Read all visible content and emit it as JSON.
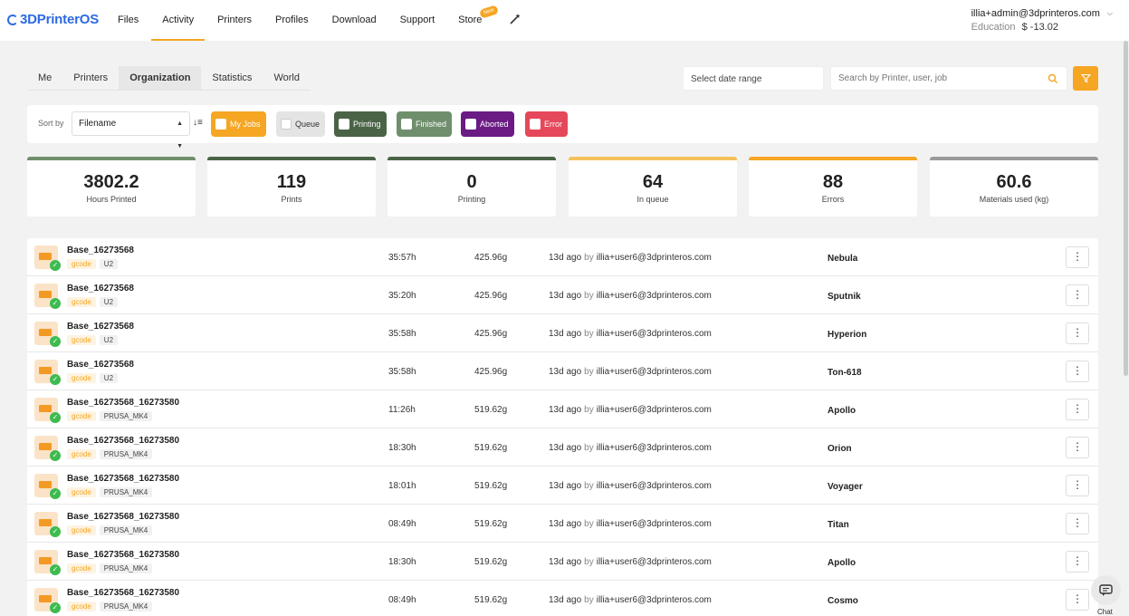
{
  "app": {
    "logo_text": "3DPrinterOS"
  },
  "nav": {
    "items": [
      {
        "label": "Files"
      },
      {
        "label": "Activity",
        "active": true
      },
      {
        "label": "Printers"
      },
      {
        "label": "Profiles"
      },
      {
        "label": "Download"
      },
      {
        "label": "Support"
      },
      {
        "label": "Store",
        "badge": "New"
      }
    ]
  },
  "user": {
    "email": "illia+admin@3dprinteros.com",
    "plan": "Education",
    "balance": "$ -13.02"
  },
  "subtabs": [
    {
      "label": "Me"
    },
    {
      "label": "Printers"
    },
    {
      "label": "Organization",
      "active": true
    },
    {
      "label": "Statistics"
    },
    {
      "label": "World"
    }
  ],
  "date_range": {
    "placeholder": "Select date range"
  },
  "search": {
    "placeholder": "Search by Printer, user, job"
  },
  "sort": {
    "label": "Sort by",
    "value": "Filename"
  },
  "filters": [
    {
      "label": "My Jobs",
      "color": "#f5a623"
    },
    {
      "label": "Queue",
      "color": "#e4e4e4"
    },
    {
      "label": "Printing",
      "color": "#4a6346"
    },
    {
      "label": "Finished",
      "color": "#6f8f6c"
    },
    {
      "label": "Aborted",
      "color": "#6a1b84"
    },
    {
      "label": "Error",
      "color": "#e5485a"
    }
  ],
  "stats": [
    {
      "value": "3802.2",
      "label": "Hours Printed",
      "color": "#6f8f6c"
    },
    {
      "value": "119",
      "label": "Prints",
      "color": "#4a6346"
    },
    {
      "value": "0",
      "label": "Printing",
      "color": "#4a6346"
    },
    {
      "value": "64",
      "label": "In queue",
      "color": "#f5c15a"
    },
    {
      "value": "88",
      "label": "Errors",
      "color": "#f5a623"
    },
    {
      "value": "60.6",
      "label": "Materials used (kg)",
      "color": "#9a9a9a"
    }
  ],
  "jobs": [
    {
      "name": "Base_16273568",
      "type": "gcode",
      "model": "U2",
      "duration": "35:57h",
      "weight": "425.96g",
      "ago": "13d ago",
      "by": "by",
      "user": "illia+user6@3dprinteros.com",
      "printer": "Nebula"
    },
    {
      "name": "Base_16273568",
      "type": "gcode",
      "model": "U2",
      "duration": "35:20h",
      "weight": "425.96g",
      "ago": "13d ago",
      "by": "by",
      "user": "illia+user6@3dprinteros.com",
      "printer": "Sputnik"
    },
    {
      "name": "Base_16273568",
      "type": "gcode",
      "model": "U2",
      "duration": "35:58h",
      "weight": "425.96g",
      "ago": "13d ago",
      "by": "by",
      "user": "illia+user6@3dprinteros.com",
      "printer": "Hyperion"
    },
    {
      "name": "Base_16273568",
      "type": "gcode",
      "model": "U2",
      "duration": "35:58h",
      "weight": "425.96g",
      "ago": "13d ago",
      "by": "by",
      "user": "illia+user6@3dprinteros.com",
      "printer": "Ton-618"
    },
    {
      "name": "Base_16273568_16273580",
      "type": "gcode",
      "model": "PRUSA_MK4",
      "duration": "11:26h",
      "weight": "519.62g",
      "ago": "13d ago",
      "by": "by",
      "user": "illia+user6@3dprinteros.com",
      "printer": "Apollo"
    },
    {
      "name": "Base_16273568_16273580",
      "type": "gcode",
      "model": "PRUSA_MK4",
      "duration": "18:30h",
      "weight": "519.62g",
      "ago": "13d ago",
      "by": "by",
      "user": "illia+user6@3dprinteros.com",
      "printer": "Orion"
    },
    {
      "name": "Base_16273568_16273580",
      "type": "gcode",
      "model": "PRUSA_MK4",
      "duration": "18:01h",
      "weight": "519.62g",
      "ago": "13d ago",
      "by": "by",
      "user": "illia+user6@3dprinteros.com",
      "printer": "Voyager"
    },
    {
      "name": "Base_16273568_16273580",
      "type": "gcode",
      "model": "PRUSA_MK4",
      "duration": "08:49h",
      "weight": "519.62g",
      "ago": "13d ago",
      "by": "by",
      "user": "illia+user6@3dprinteros.com",
      "printer": "Titan"
    },
    {
      "name": "Base_16273568_16273580",
      "type": "gcode",
      "model": "PRUSA_MK4",
      "duration": "18:30h",
      "weight": "519.62g",
      "ago": "13d ago",
      "by": "by",
      "user": "illia+user6@3dprinteros.com",
      "printer": "Apollo"
    },
    {
      "name": "Base_16273568_16273580",
      "type": "gcode",
      "model": "PRUSA_MK4",
      "duration": "08:49h",
      "weight": "519.62g",
      "ago": "13d ago",
      "by": "by",
      "user": "illia+user6@3dprinteros.com",
      "printer": "Cosmo"
    }
  ],
  "chat": {
    "label": "Chat"
  },
  "icons": {
    "search": "search-icon",
    "filter": "filter-icon",
    "menu": "kebab-menu-icon",
    "chat": "chat-icon",
    "wand": "magic-wand-icon"
  }
}
